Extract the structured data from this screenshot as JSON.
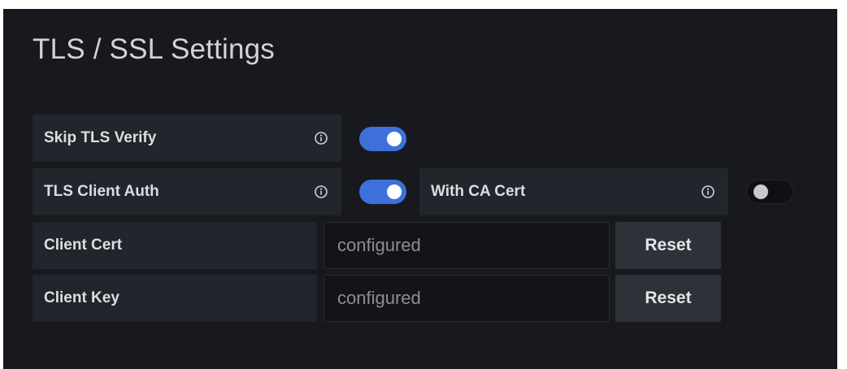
{
  "section": {
    "title": "TLS / SSL Settings"
  },
  "rows": {
    "skip_tls_verify": {
      "label": "Skip TLS Verify",
      "enabled": true
    },
    "tls_client_auth": {
      "label": "TLS Client Auth",
      "enabled": true
    },
    "with_ca_cert": {
      "label": "With CA Cert",
      "enabled": false
    },
    "client_cert": {
      "label": "Client Cert",
      "placeholder": "configured",
      "value": "",
      "reset_label": "Reset"
    },
    "client_key": {
      "label": "Client Key",
      "placeholder": "configured",
      "value": "",
      "reset_label": "Reset"
    }
  },
  "colors": {
    "panel_bg": "#18191e",
    "label_bg": "#22252b",
    "toggle_on": "#3d71d9",
    "toggle_off": "#0f1014",
    "button_bg": "#2e3138"
  },
  "icons": {
    "info": "info-circle-icon"
  }
}
